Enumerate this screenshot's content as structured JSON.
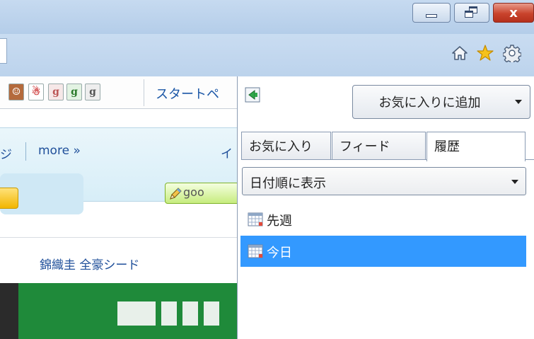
{
  "window": {
    "min_button": "minimize",
    "max_button": "restore",
    "close_glyph": "x"
  },
  "toolbar": {
    "icons": [
      "home-icon",
      "favorites-star-icon",
      "settings-gear-icon"
    ]
  },
  "page": {
    "favorites_bar_link": "スタートペ",
    "nav_text": "ジ",
    "more_link": "more »",
    "cut_text": "イ",
    "goo_button": "goo",
    "news_link": "錦織圭 全豪シード"
  },
  "pane": {
    "add_favorites_label": "お気に入りに追加",
    "tabs": [
      {
        "label": "お気に入り"
      },
      {
        "label": "フィード"
      },
      {
        "label": "履歴"
      }
    ],
    "active_tab": "履歴",
    "view_select": {
      "value": "日付順に表示"
    },
    "history": [
      {
        "label": "先週"
      },
      {
        "label": "今日"
      }
    ],
    "selected_item": "今日"
  },
  "colors": {
    "selection": "#3399ff",
    "chrome": "#bcd3ec",
    "close": "#c9432c"
  }
}
